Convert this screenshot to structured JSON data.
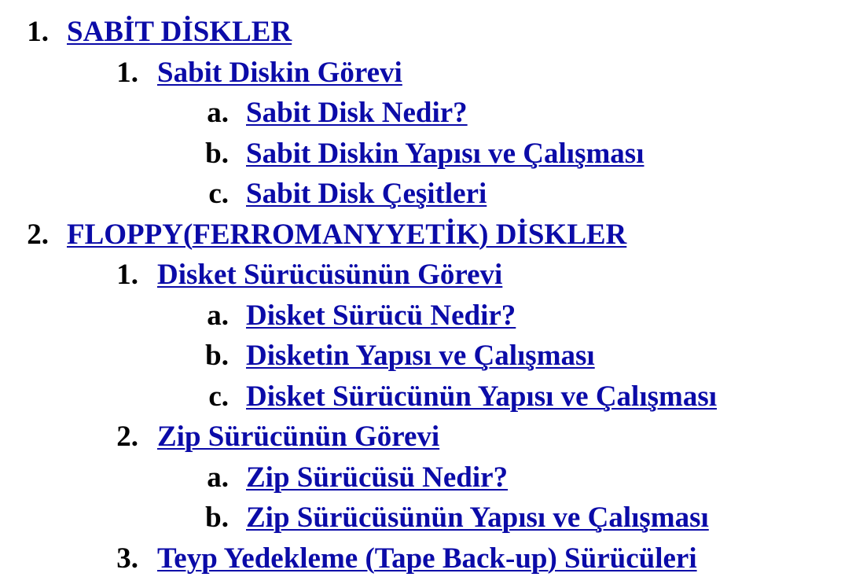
{
  "toc": {
    "link_color": "#0b0ba8",
    "entries": [
      {
        "marker": "1.",
        "text": "SABİT DİSKLER"
      },
      {
        "marker": "1.",
        "text": "Sabit Diskin Görevi"
      },
      {
        "marker": "a.",
        "text": "Sabit Disk Nedir?"
      },
      {
        "marker": "b.",
        "text": "Sabit Diskin Yapısı ve Çalışması"
      },
      {
        "marker": "c.",
        "text": "Sabit Disk Çeşitleri"
      },
      {
        "marker": "2.",
        "text": "FLOPPY(FERROMANYYETİK) DİSKLER"
      },
      {
        "marker": "1.",
        "text": "Disket Sürücüsünün Görevi"
      },
      {
        "marker": "a.",
        "text": "Disket Sürücü Nedir?"
      },
      {
        "marker": "b.",
        "text": "Disketin Yapısı ve Çalışması"
      },
      {
        "marker": "c.",
        "text": "Disket Sürücünün Yapısı ve Çalışması"
      },
      {
        "marker": "2.",
        "text": "Zip Sürücünün Görevi"
      },
      {
        "marker": "a.",
        "text": "Zip Sürücüsü Nedir?"
      },
      {
        "marker": "b.",
        "text": "Zip Sürücüsünün Yapısı ve Çalışması"
      },
      {
        "marker": "3.",
        "text": "Teyp Yedekleme (Tape Back-up) Sürücüleri"
      }
    ]
  }
}
